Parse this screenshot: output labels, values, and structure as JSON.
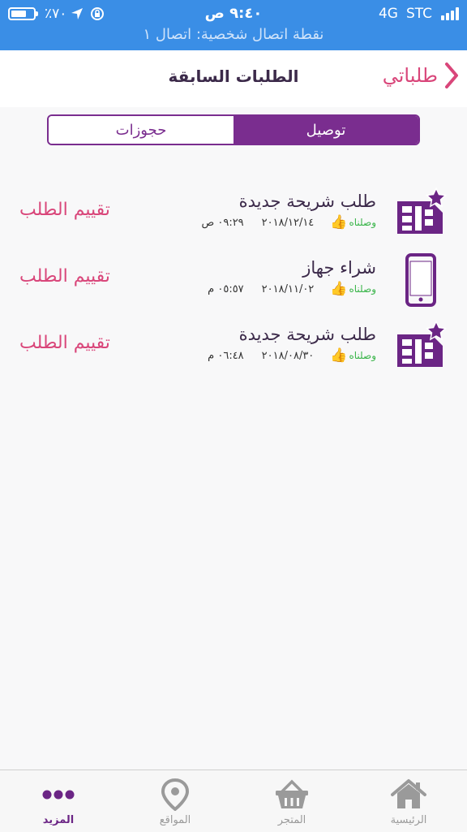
{
  "status_bar": {
    "carrier": "STC",
    "network": "4G",
    "time": "٩:٤٠ ص",
    "battery": "٪٧٠",
    "battery_level": 0.7,
    "hotspot_text": "نقطة اتصال شخصية: اتصال ١"
  },
  "nav": {
    "back_label": "طلباتي",
    "title": "الطلبات السابقة"
  },
  "segments": {
    "delivery": "توصيل",
    "bookings": "حجوزات",
    "active": "delivery"
  },
  "orders": [
    {
      "title": "طلب شريحة جديدة",
      "status": "وصلناه",
      "date": "٢٠١٨/١٢/١٤",
      "time": "٠٩:٢٩ ص",
      "rate_label": "تقييم الطلب",
      "icon": "sim-card-star-icon"
    },
    {
      "title": "شراء جهاز",
      "status": "وصلناه",
      "date": "٢٠١٨/١١/٠٢",
      "time": "٠٥:٥٧ م",
      "rate_label": "تقييم الطلب",
      "icon": "smartphone-icon"
    },
    {
      "title": "طلب شريحة جديدة",
      "status": "وصلناه",
      "date": "٢٠١٨/٠٨/٣٠",
      "time": "٠٦:٤٨ م",
      "rate_label": "تقييم الطلب",
      "icon": "sim-card-star-icon"
    }
  ],
  "tabbar": {
    "more": "المزيد",
    "locations": "المواقع",
    "store": "المتجر",
    "home": "الرئيسية",
    "active": "more"
  },
  "colors": {
    "status_bar": "#3a8ee6",
    "brand_purple": "#7a2d8f",
    "accent_pink": "#d9467a",
    "delivered_green": "#3ab54a"
  }
}
